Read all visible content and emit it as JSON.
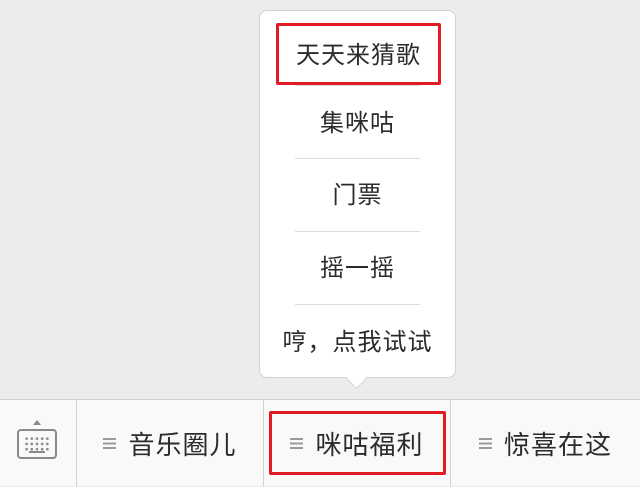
{
  "submenu": {
    "items": [
      {
        "label": "天天来猜歌",
        "highlighted": true
      },
      {
        "label": "集咪咕",
        "highlighted": false
      },
      {
        "label": "门票",
        "highlighted": false
      },
      {
        "label": "摇一摇",
        "highlighted": false
      },
      {
        "label": "哼，点我试试",
        "highlighted": false
      }
    ]
  },
  "bottom_bar": {
    "keyboard_icon": "keyboard-icon",
    "tabs": [
      {
        "label": "音乐圈儿",
        "icon": "menu-lines-icon"
      },
      {
        "label": "咪咕福利",
        "icon": "menu-lines-icon",
        "highlighted": true
      },
      {
        "label": "惊喜在这",
        "icon": "menu-lines-icon"
      }
    ]
  },
  "colors": {
    "highlight_border": "#e21a24",
    "background": "#ececec",
    "bar_background": "#f9f9f9"
  }
}
